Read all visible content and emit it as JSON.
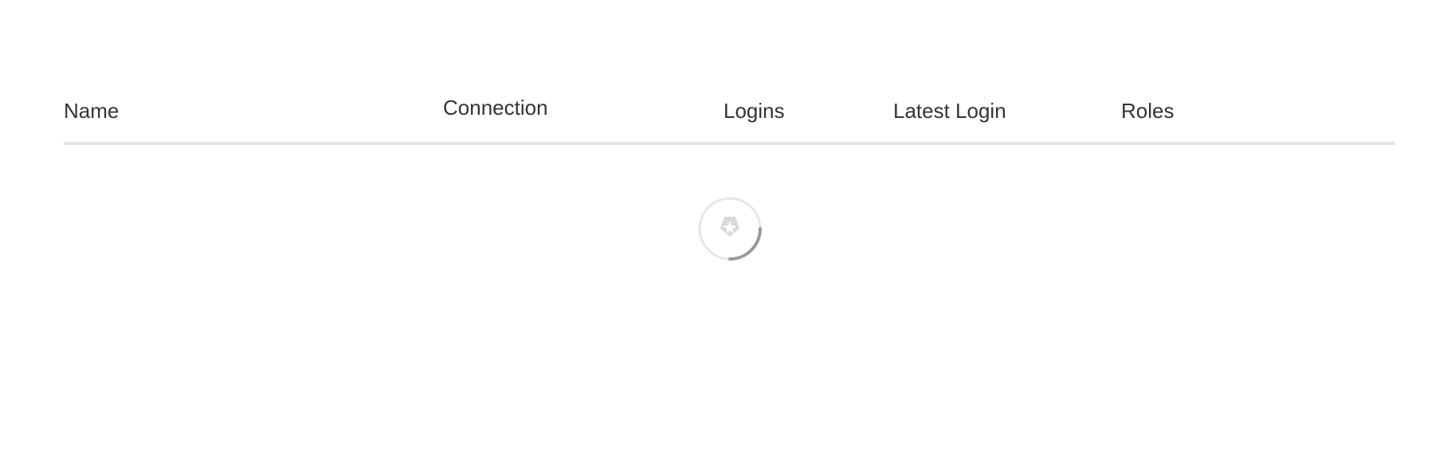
{
  "table": {
    "columns": [
      {
        "label": "Name"
      },
      {
        "label": "Connection"
      },
      {
        "label": "Logins"
      },
      {
        "label": "Latest Login"
      },
      {
        "label": "Roles"
      }
    ],
    "rows": []
  },
  "loading": {
    "icon": "auth0-shield-icon",
    "colors": {
      "ring": "#e6e6e6",
      "arc": "#999999",
      "shield": "#d9d9d9"
    }
  }
}
